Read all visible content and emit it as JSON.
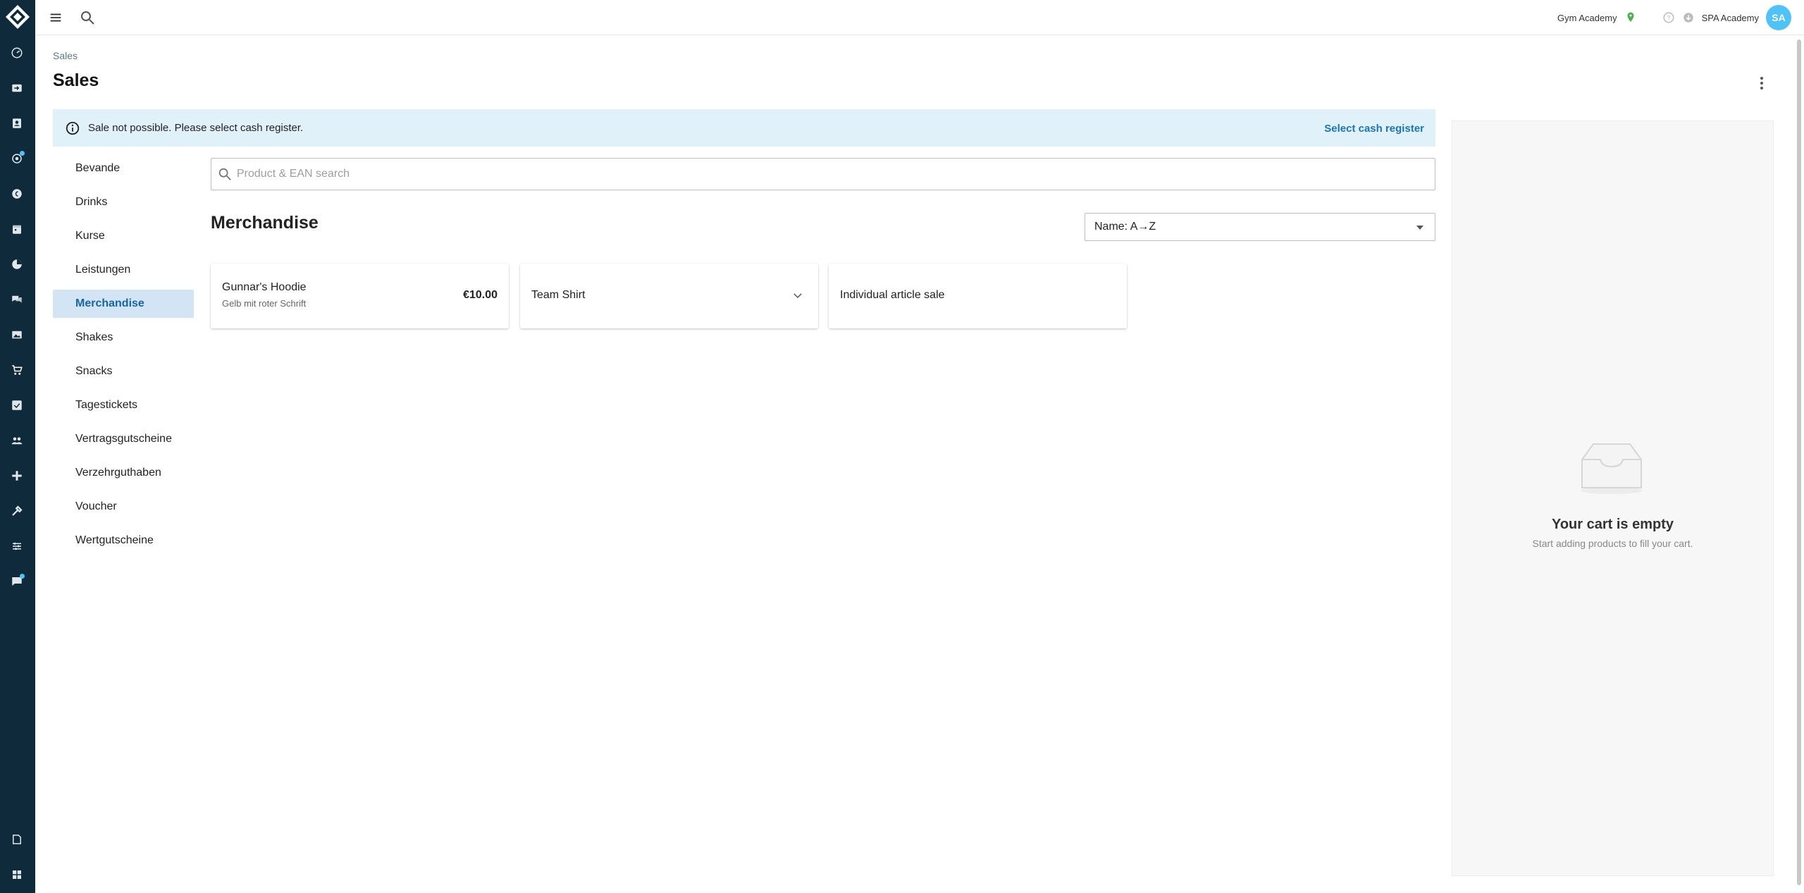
{
  "topbar": {
    "location": "Gym Academy",
    "studio": "SPA Academy",
    "user_initials": "SA"
  },
  "header": {
    "breadcrumb": "Sales",
    "title": "Sales"
  },
  "alert": {
    "message": "Sale not possible. Please select cash register.",
    "action": "Select cash register"
  },
  "categories": [
    {
      "label": "Bevande",
      "active": false
    },
    {
      "label": "Drinks",
      "active": false
    },
    {
      "label": "Kurse",
      "active": false
    },
    {
      "label": "Leistungen",
      "active": false
    },
    {
      "label": "Merchandise",
      "active": true
    },
    {
      "label": "Shakes",
      "active": false
    },
    {
      "label": "Snacks",
      "active": false
    },
    {
      "label": "Tagestickets",
      "active": false
    },
    {
      "label": "Vertragsgutscheine",
      "active": false
    },
    {
      "label": "Verzehrguthaben",
      "active": false
    },
    {
      "label": "Voucher",
      "active": false
    },
    {
      "label": "Wertgutscheine",
      "active": false
    }
  ],
  "search": {
    "placeholder": "Product & EAN search",
    "value": ""
  },
  "section": {
    "title": "Merchandise",
    "sort_value": "Name: A→Z"
  },
  "products": [
    {
      "name": "Gunnar's Hoodie",
      "subtitle": "Gelb mit roter Schrift",
      "price": "€10.00"
    },
    {
      "name": "Team Shirt",
      "has_variants": true
    },
    {
      "name": "Individual article sale"
    }
  ],
  "cart": {
    "empty_title": "Your cart is empty",
    "empty_subtitle": "Start adding products to fill your cart."
  },
  "colors": {
    "rail": "#0f2a3a",
    "accent": "#1976b9",
    "alert_bg": "#e1f1fa",
    "active_cat_bg": "#d3e5f4",
    "avatar": "#4fc3f7",
    "location_pin": "#4caf50"
  },
  "rail_icons": [
    "dashboard-icon",
    "checkin-icon",
    "contacts-icon",
    "leads-icon",
    "finance-icon",
    "calendar-icon",
    "analytics-icon",
    "chat-icon",
    "gallery-icon",
    "cart-icon",
    "tasks-icon",
    "members-icon",
    "integrations-icon",
    "tools-icon",
    "settings-icon",
    "feedback-icon",
    "docs-icon",
    "apps-icon"
  ]
}
